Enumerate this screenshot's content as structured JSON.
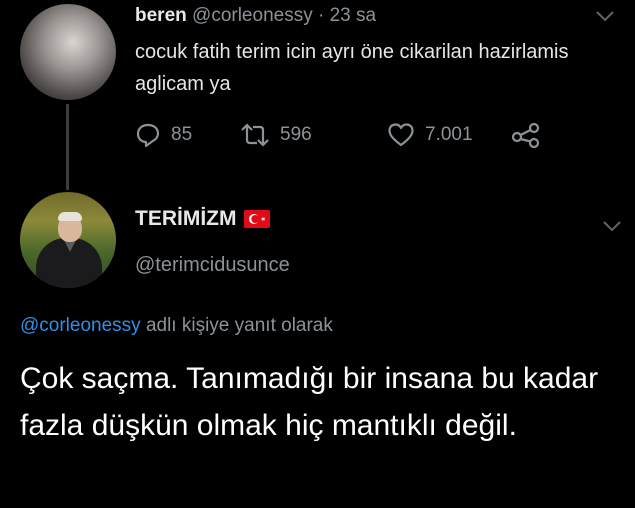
{
  "tweet1": {
    "author_name": "beren",
    "handle": "@corleonessy",
    "separator": "·",
    "time": "23 sa",
    "text": "cocuk fatih terim icin ayrı öne cikarilan hazirlamis aglicam ya",
    "actions": {
      "reply_count": "85",
      "retweet_count": "596",
      "like_count": "7.001"
    }
  },
  "tweet2": {
    "author_name": "TERİMİZM",
    "handle": "@terimcidusunce",
    "reply_to_handle": "@corleonessy",
    "reply_to_suffix": " adlı kişiye yanıt olarak",
    "text": "Çok saçma. Tanımadığı bir insana bu kadar fazla düşkün olmak hiç mantıklı değil."
  },
  "icons": {
    "reply": "reply-icon",
    "retweet": "retweet-icon",
    "like": "heart-icon",
    "share": "share-icon",
    "more": "chevron-down-icon",
    "flag": "turkey-flag-icon"
  },
  "colors": {
    "background": "#000000",
    "primary_text": "#e6e6e6",
    "secondary_text": "#8b9298",
    "link": "#2f8ee8",
    "flag_red": "#e30a17"
  }
}
